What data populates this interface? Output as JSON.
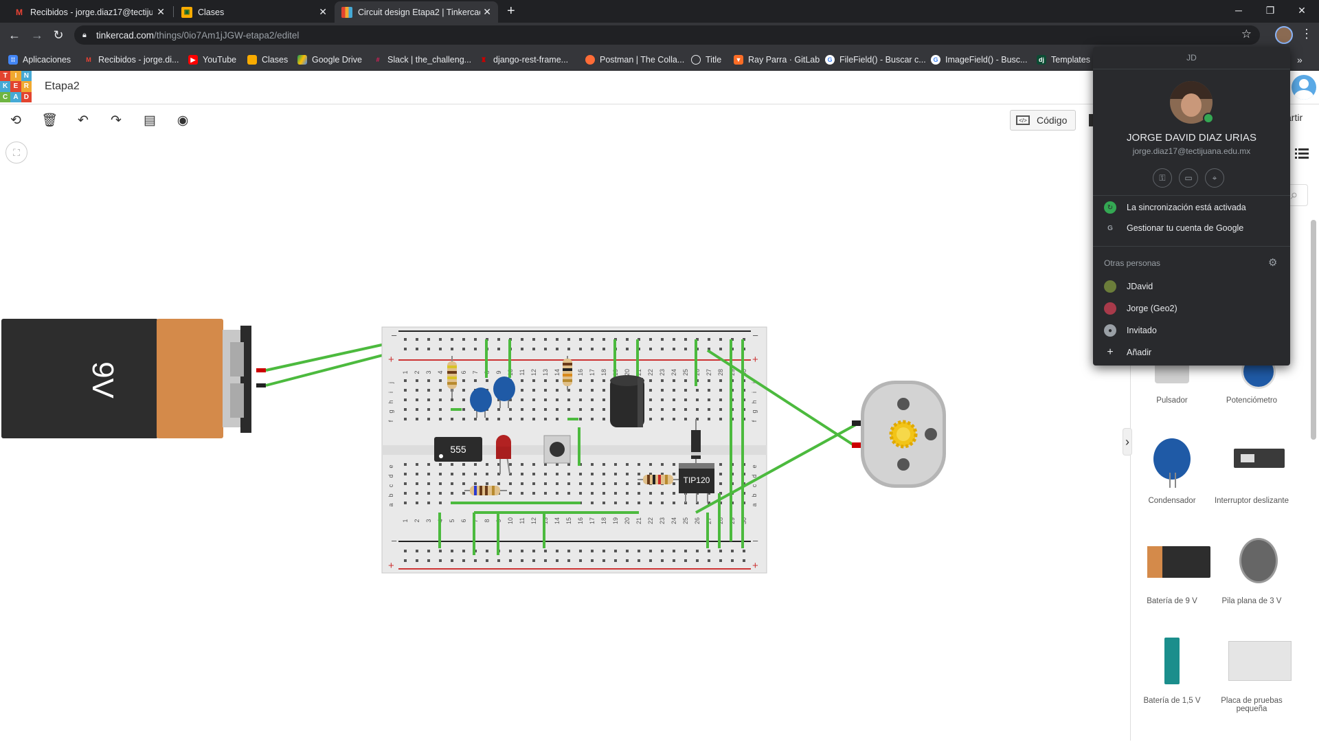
{
  "browser": {
    "tabs": [
      {
        "title": "Recibidos - jorge.diaz17@tectiju...",
        "icon": "gmail-icon",
        "active": false
      },
      {
        "title": "Clases",
        "icon": "classroom-icon",
        "active": false
      },
      {
        "title": "Circuit design Etapa2 | Tinkercad",
        "icon": "tinkercad-icon",
        "active": true
      }
    ],
    "url_host": "tinkercad.com",
    "url_path": "/things/0io7Am1jJGW-etapa2/editel",
    "bookmarks": [
      "Aplicaciones",
      "Recibidos - jorge.di...",
      "YouTube",
      "Clases",
      "Google Drive",
      "Slack | the_challeng...",
      "django-rest-frame...",
      "Postman | The Colla...",
      "Title",
      "Ray Parra · GitLab",
      "FileField() - Buscar c...",
      "ImageField() - Busc...",
      "Templates"
    ]
  },
  "app": {
    "logo_letters": [
      "TIN",
      "KER",
      "CAD"
    ],
    "project_title": "Etapa2",
    "code_button": "Código",
    "share_partial": "artir"
  },
  "circuit": {
    "battery_label": "9V",
    "ic_label": "555",
    "transistor_label": "TIP120",
    "breadboard_columns": [
      "1",
      "2",
      "3",
      "4",
      "5",
      "6",
      "7",
      "8",
      "9",
      "10",
      "11",
      "12",
      "13",
      "14",
      "15",
      "16",
      "17",
      "18",
      "19",
      "20",
      "21",
      "22",
      "23",
      "24",
      "25",
      "26",
      "27",
      "28",
      "29",
      "30"
    ],
    "breadboard_rows_top": [
      "j",
      "i",
      "h",
      "g",
      "f"
    ],
    "breadboard_rows_bottom": [
      "e",
      "d",
      "c",
      "b",
      "a"
    ],
    "rail_minus": "–",
    "rail_plus": "+"
  },
  "components": [
    {
      "label": "Pulsador"
    },
    {
      "label": "Potenciómetro"
    },
    {
      "label": "Condensador"
    },
    {
      "label": "Interruptor deslizante"
    },
    {
      "label": "Batería de 9 V"
    },
    {
      "label": "Pila plana de 3 V"
    },
    {
      "label": "Batería de 1,5 V"
    },
    {
      "label": "Placa de pruebas pequeña"
    }
  ],
  "profile": {
    "initials": "JD",
    "name": "JORGE DAVID DIAZ URIAS",
    "email": "jorge.diaz17@tectijuana.edu.mx",
    "sync": "La sincronización está activada",
    "manage": "Gestionar tu cuenta de Google",
    "other_people": "Otras personas",
    "people": [
      "JDavid",
      "Jorge (Geo2)",
      "Invitado",
      "Añadir"
    ]
  }
}
